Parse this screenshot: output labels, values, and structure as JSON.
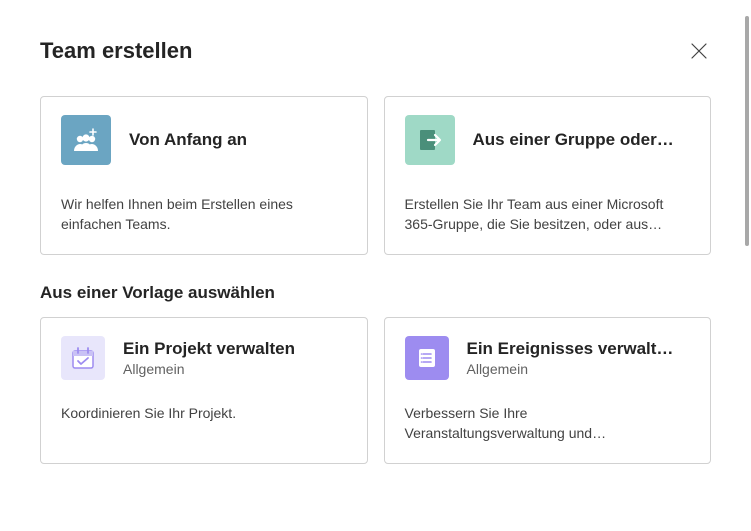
{
  "header": {
    "title": "Team erstellen"
  },
  "cards": {
    "scratch": {
      "title": "Von Anfang an",
      "desc": "Wir helfen Ihnen beim Erstellen eines einfachen Teams."
    },
    "group": {
      "title": "Aus einer Gruppe oder…",
      "desc": "Erstellen Sie Ihr Team aus einer Microsoft 365-Gruppe, die Sie besitzen, oder aus…"
    }
  },
  "section": {
    "templates_title": "Aus einer Vorlage auswählen"
  },
  "templates": {
    "project": {
      "title": "Ein Projekt verwalten",
      "category": "Allgemein",
      "desc": "Koordinieren Sie Ihr Projekt."
    },
    "event": {
      "title": "Ein Ereignisses verwalt…",
      "category": "Allgemein",
      "desc": "Verbessern Sie Ihre Veranstaltungsverwaltung und…"
    }
  }
}
